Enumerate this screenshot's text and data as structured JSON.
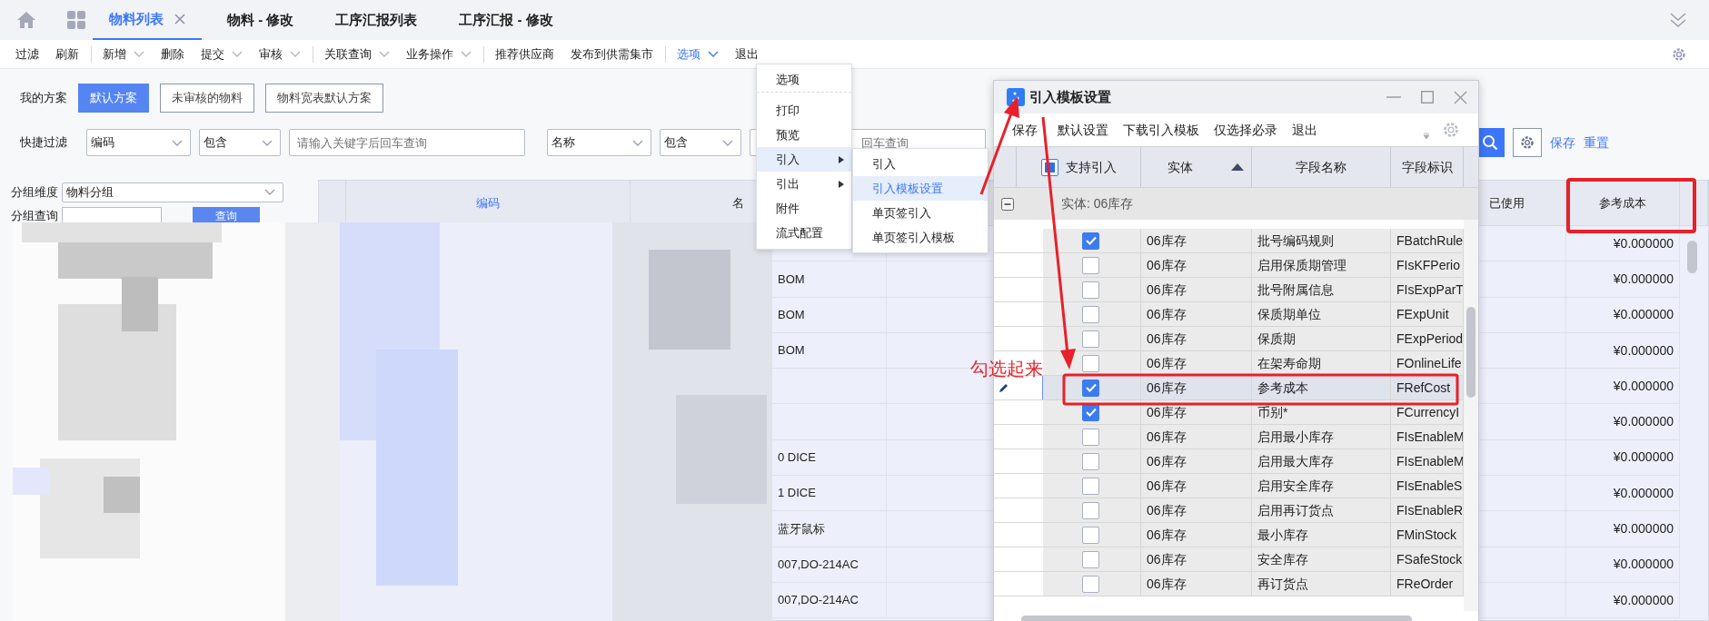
{
  "tabs": [
    {
      "label": "物料列表",
      "selected": true,
      "closable": true
    },
    {
      "label": "物料 - 修改",
      "selected": false,
      "closable": false
    },
    {
      "label": "工序汇报列表",
      "selected": false,
      "closable": false
    },
    {
      "label": "工序汇报 - 修改",
      "selected": false,
      "closable": false
    }
  ],
  "toolbar": [
    {
      "label": "过滤",
      "dropdown": false,
      "divider_before": false,
      "open": false
    },
    {
      "label": "刷新",
      "dropdown": false,
      "divider_before": false,
      "open": false
    },
    {
      "label": "新增",
      "dropdown": true,
      "divider_before": true,
      "open": false
    },
    {
      "label": "删除",
      "dropdown": false,
      "divider_before": false,
      "open": false
    },
    {
      "label": "提交",
      "dropdown": true,
      "divider_before": false,
      "open": false
    },
    {
      "label": "审核",
      "dropdown": true,
      "divider_before": false,
      "open": false
    },
    {
      "label": "关联查询",
      "dropdown": true,
      "divider_before": true,
      "open": false
    },
    {
      "label": "业务操作",
      "dropdown": true,
      "divider_before": false,
      "open": false
    },
    {
      "label": "推荐供应商",
      "dropdown": false,
      "divider_before": true,
      "open": false
    },
    {
      "label": "发布到供需集市",
      "dropdown": false,
      "divider_before": false,
      "open": false
    },
    {
      "label": "选项",
      "dropdown": true,
      "divider_before": true,
      "open": true
    },
    {
      "label": "退出",
      "dropdown": false,
      "divider_before": false,
      "open": false
    }
  ],
  "scheme": {
    "label": "我的方案",
    "options": [
      {
        "label": "默认方案",
        "selected": true
      },
      {
        "label": "未审核的物料",
        "selected": false
      },
      {
        "label": "物料宽表默认方案",
        "selected": false
      }
    ]
  },
  "quick_filter": {
    "label": "快捷过滤",
    "fields": [
      {
        "kind": "select",
        "value": "编码"
      },
      {
        "kind": "select",
        "value": "包含"
      },
      {
        "kind": "input",
        "placeholder": "请输入关键字后回车查询"
      },
      {
        "kind": "select",
        "value": "名称"
      },
      {
        "kind": "select",
        "value": "包含"
      },
      {
        "kind": "input",
        "placeholder": "回车查询"
      }
    ],
    "save": "保存",
    "reset": "重置"
  },
  "group_panel": {
    "dimension_label": "分组维度",
    "dimension_value": "物料分组",
    "query_label": "分组查询",
    "query_button": "查询"
  },
  "grid": {
    "columns": [
      {
        "label": "编码",
        "highlighted": true
      },
      {
        "label": "名",
        "highlighted": false
      },
      {
        "label": "已使用",
        "highlighted": false
      },
      {
        "label": "参考成本",
        "highlighted": false
      }
    ],
    "rows": [
      {
        "cost": "¥0.000000"
      },
      {
        "name": "BOM",
        "cost": "¥0.000000"
      },
      {
        "name": "BOM",
        "cost": "¥0.000000"
      },
      {
        "name": "BOM",
        "cost": "¥0.000000"
      },
      {
        "cost": "¥0.000000"
      },
      {
        "cost": "¥0.000000"
      },
      {
        "name": "0 DICE",
        "cost": "¥0.000000"
      },
      {
        "name": "1 DICE",
        "cost": "¥0.000000"
      },
      {
        "name": "蓝牙鼠标",
        "cost": "¥0.000000"
      },
      {
        "name": "007,DO-214AC",
        "cost": "¥0.000000"
      },
      {
        "name": "007,DO-214AC",
        "cost": "¥0.000000"
      }
    ]
  },
  "options_menu": {
    "items": [
      {
        "label": "选项",
        "submenu": false,
        "highlighted": false,
        "divider_after": true
      },
      {
        "label": "打印",
        "submenu": false,
        "highlighted": false,
        "divider_after": false
      },
      {
        "label": "预览",
        "submenu": false,
        "highlighted": false,
        "divider_after": false
      },
      {
        "label": "引入",
        "submenu": true,
        "highlighted": true,
        "divider_after": false
      },
      {
        "label": "引出",
        "submenu": true,
        "highlighted": false,
        "divider_after": false
      },
      {
        "label": "附件",
        "submenu": false,
        "highlighted": false,
        "divider_after": false
      },
      {
        "label": "流式配置",
        "submenu": false,
        "highlighted": false,
        "divider_after": false
      }
    ]
  },
  "import_submenu": {
    "items": [
      {
        "label": "引入",
        "highlighted": false
      },
      {
        "label": "引入模板设置",
        "highlighted": true
      },
      {
        "label": "单页签引入",
        "highlighted": false
      },
      {
        "label": "单页签引入模板",
        "highlighted": false
      }
    ]
  },
  "dialog": {
    "title": "引入模板设置",
    "toolbar": [
      "保存",
      "默认设置",
      "下载引入模板",
      "仅选择必录",
      "退出"
    ],
    "select_all_partial": true,
    "columns": [
      {
        "label": "支持引入",
        "sorted": false
      },
      {
        "label": "实体",
        "sorted": true
      },
      {
        "label": "字段名称",
        "sorted": false
      },
      {
        "label": "字段标识",
        "sorted": false
      }
    ],
    "group": "实体: 06库存",
    "rows": [
      {
        "checked": true,
        "selected": false,
        "entity": "06库存",
        "field_name": "批号编码规则",
        "field_key": "FBatchRule"
      },
      {
        "checked": false,
        "selected": false,
        "entity": "06库存",
        "field_name": "启用保质期管理",
        "field_key": "FIsKFPerio"
      },
      {
        "checked": false,
        "selected": false,
        "entity": "06库存",
        "field_name": "批号附属信息",
        "field_key": "FIsExpParT"
      },
      {
        "checked": false,
        "selected": false,
        "entity": "06库存",
        "field_name": "保质期单位",
        "field_key": "FExpUnit"
      },
      {
        "checked": false,
        "selected": false,
        "entity": "06库存",
        "field_name": "保质期",
        "field_key": "FExpPeriod"
      },
      {
        "checked": false,
        "selected": false,
        "entity": "06库存",
        "field_name": "在架寿命期",
        "field_key": "FOnlineLife"
      },
      {
        "checked": true,
        "selected": true,
        "entity": "06库存",
        "field_name": "参考成本",
        "field_key": "FRefCost"
      },
      {
        "checked": true,
        "selected": false,
        "entity": "06库存",
        "field_name": "币别*",
        "field_key": "FCurrencyI"
      },
      {
        "checked": false,
        "selected": false,
        "entity": "06库存",
        "field_name": "启用最小库存",
        "field_key": "FIsEnableM"
      },
      {
        "checked": false,
        "selected": false,
        "entity": "06库存",
        "field_name": "启用最大库存",
        "field_key": "FIsEnableM"
      },
      {
        "checked": false,
        "selected": false,
        "entity": "06库存",
        "field_name": "启用安全库存",
        "field_key": "FIsEnableS"
      },
      {
        "checked": false,
        "selected": false,
        "entity": "06库存",
        "field_name": "启用再订货点",
        "field_key": "FIsEnableR"
      },
      {
        "checked": false,
        "selected": false,
        "entity": "06库存",
        "field_name": "最小库存",
        "field_key": "FMinStock"
      },
      {
        "checked": false,
        "selected": false,
        "entity": "06库存",
        "field_name": "安全库存",
        "field_key": "FSafeStock"
      },
      {
        "checked": false,
        "selected": false,
        "entity": "06库存",
        "field_name": "再订货点",
        "field_key": "FReOrder"
      }
    ]
  },
  "annotations": {
    "note": "勾选起来"
  }
}
